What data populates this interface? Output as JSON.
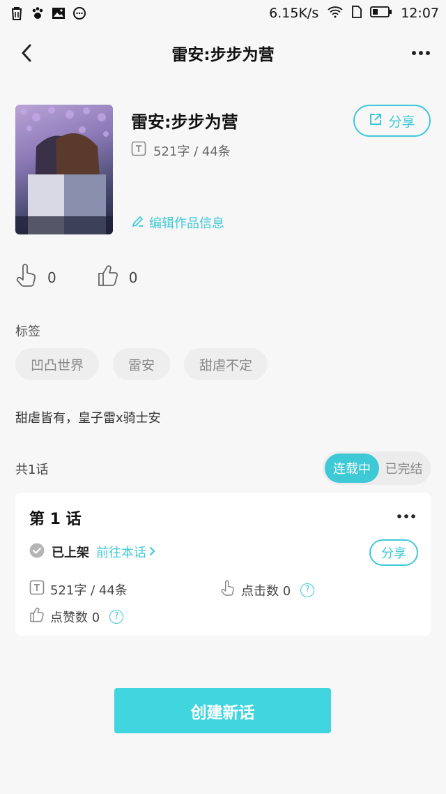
{
  "status_bar": {
    "net_speed": "6.15K/s",
    "time": "12:07",
    "left_icons": [
      "trash-icon",
      "paw-icon",
      "image-icon",
      "chat-icon"
    ]
  },
  "nav": {
    "title": "雷安:步步为营"
  },
  "work": {
    "title": "雷安:步步为营",
    "stats": "521字 / 44条",
    "edit_label": "编辑作品信息",
    "share_label": "分享"
  },
  "reactions": {
    "down_count": "0",
    "up_count": "0"
  },
  "tags": {
    "label": "标签",
    "items": [
      "凹凸世界",
      "雷安",
      "甜虐不定"
    ]
  },
  "description": "甜虐皆有，皇子雷x骑士安",
  "episodes": {
    "count_label": "共1话",
    "segment": {
      "active": "连载中",
      "inactive": "已完结"
    },
    "card": {
      "title": "第 1 话",
      "status": "已上架",
      "goto_label": "前往本话",
      "share_label": "分享",
      "stats": "521字 / 44条",
      "clicks": "点击数 0",
      "likes": "点赞数 0"
    }
  },
  "create_button": "创建新话",
  "colors": {
    "accent": "#3ec9d6",
    "button": "#41d5e0",
    "background": "#f7f7f7"
  }
}
